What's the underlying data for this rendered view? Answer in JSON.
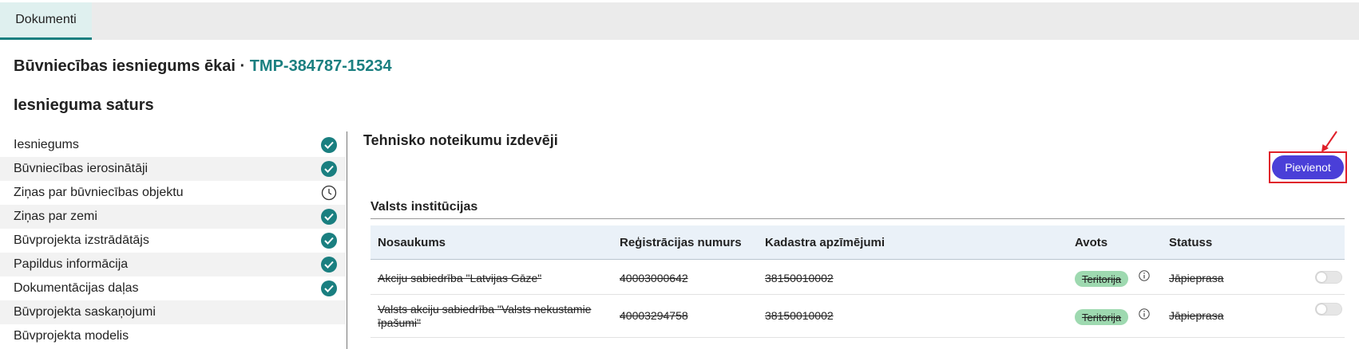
{
  "tabs": [
    {
      "label": "Dokumenti",
      "active": true
    }
  ],
  "header": {
    "title": "Būvniecības iesniegums ēkai · ",
    "code": "TMP-384787-15234"
  },
  "content_title": "Iesnieguma saturs",
  "sidebar": {
    "items": [
      {
        "label": "Iesniegums",
        "status": "check-circle-icon"
      },
      {
        "label": "Būvniecības ierosinātāji",
        "status": "check-circle-icon"
      },
      {
        "label": "Ziņas par būvniecības objektu",
        "status": "clock-icon"
      },
      {
        "label": "Ziņas par zemi",
        "status": "check-circle-icon"
      },
      {
        "label": "Būvprojekta izstrādātājs",
        "status": "check-circle-icon"
      },
      {
        "label": "Papildus informācija",
        "status": "check-circle-icon"
      },
      {
        "label": "Dokumentācijas daļas",
        "status": "check-circle-icon"
      },
      {
        "label": "Būvprojekta saskaņojumi",
        "status": ""
      },
      {
        "label": "Būvprojekta modelis",
        "status": ""
      }
    ]
  },
  "main": {
    "title": "Tehnisko noteikumu izdevēji",
    "add_button": "Pievienot",
    "group_title": "Valsts institūcijas",
    "columns": [
      "Nosaukums",
      "Reģistrācijas numurs",
      "Kadastra apzīmējumi",
      "Avots",
      "Statuss"
    ],
    "rows": [
      {
        "name": "Akciju sabiedrība \"Latvijas Gāze\"",
        "reg": "40003000642",
        "cadastre": "38150010002",
        "source": "Teritorija",
        "status": "Jāpieprasa"
      },
      {
        "name": "Valsts akciju sabiedrība \"Valsts nekustamie īpašumi\"",
        "reg": "40003294758",
        "cadastre": "38150010002",
        "source": "Teritorija",
        "status": "Jāpieprasa"
      }
    ]
  },
  "colors": {
    "accent": "#1a7f80",
    "button": "#4a3fd8",
    "highlight": "#e0202a",
    "badge": "#9ed9b0"
  }
}
